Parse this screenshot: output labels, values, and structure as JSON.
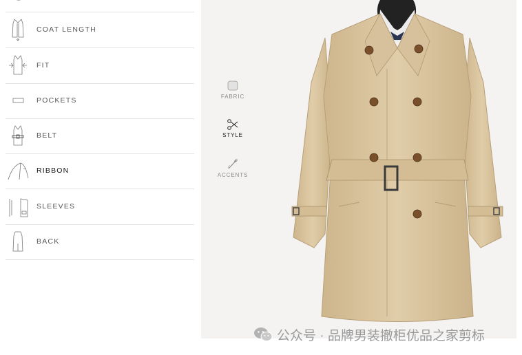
{
  "options": [
    {
      "id": "coat-length",
      "label": "COAT LENGTH",
      "icon": "coat-length-icon"
    },
    {
      "id": "fit",
      "label": "FIT",
      "icon": "fit-icon"
    },
    {
      "id": "pockets",
      "label": "POCKETS",
      "icon": "pockets-icon"
    },
    {
      "id": "belt",
      "label": "BELT",
      "icon": "belt-icon"
    },
    {
      "id": "ribbon",
      "label": "RIBBON",
      "icon": "ribbon-icon",
      "active": true
    },
    {
      "id": "sleeves",
      "label": "SLEEVES",
      "icon": "sleeves-icon"
    },
    {
      "id": "back",
      "label": "BACK",
      "icon": "back-icon"
    }
  ],
  "categories": [
    {
      "id": "fabric",
      "label": "FABRIC",
      "icon": "fabric-swatch-icon"
    },
    {
      "id": "style",
      "label": "STYLE",
      "icon": "scissors-icon",
      "active": true
    },
    {
      "id": "accents",
      "label": "ACCENTS",
      "icon": "needle-icon"
    }
  ],
  "preview": {
    "image": "trench-coat-preview",
    "coat_color": "#dcc7a1",
    "background": "#f4f3f2"
  },
  "watermark": {
    "text": "公众号 · 品牌男装撤柜优品之家剪标",
    "icon": "wechat-icon"
  }
}
